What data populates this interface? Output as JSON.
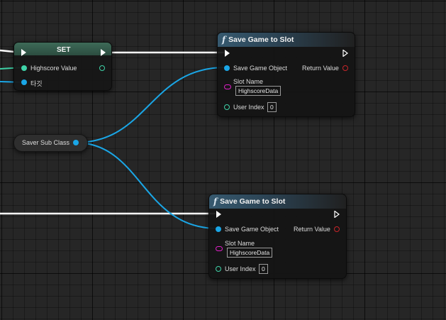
{
  "graph": {
    "set_node": {
      "title": "SET",
      "pins": {
        "highscore_value": "Highscore Value",
        "target": "타깃"
      }
    },
    "sub_class_node": {
      "label": "Saver Sub Class"
    },
    "save_nodes": [
      {
        "title": "Save Game to Slot",
        "pins": {
          "save_game_object": "Save Game Object",
          "return_value": "Return Value",
          "slot_name": "Slot Name",
          "slot_name_value": "HighscoreData",
          "user_index": "User Index",
          "user_index_value": "0"
        }
      },
      {
        "title": "Save Game to Slot",
        "pins": {
          "save_game_object": "Save Game Object",
          "return_value": "Return Value",
          "slot_name": "Slot Name",
          "slot_name_value": "HighscoreData",
          "user_index": "User Index",
          "user_index_value": "0"
        }
      }
    ],
    "colors": {
      "exec_wire": "#ffffff",
      "object_wire": "#1aa6e6",
      "float_wire": "#3fd3a8",
      "string_pin": "#e020c9",
      "return_pin": "#c8252a"
    }
  }
}
